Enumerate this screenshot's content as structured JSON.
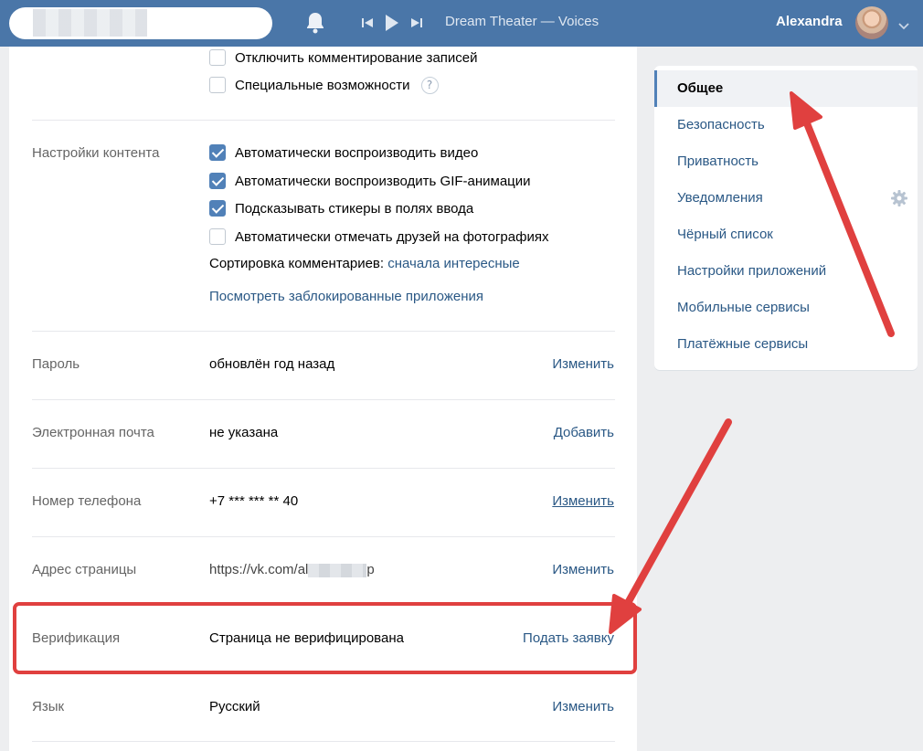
{
  "header": {
    "track": "Dream Theater — Voices",
    "user_name": "Alexandra",
    "icons": [
      "bell-icon",
      "prev-track-icon",
      "play-icon",
      "next-track-icon",
      "chevron-down-icon"
    ]
  },
  "privacy_checkboxes": [
    {
      "label": "Отключить комментирование записей",
      "checked": false
    },
    {
      "label": "Специальные возможности",
      "checked": false,
      "help": "?"
    }
  ],
  "content_settings": {
    "label": "Настройки контента",
    "options": [
      {
        "label": "Автоматически воспроизводить видео",
        "checked": true
      },
      {
        "label": "Автоматически воспроизводить GIF-анимации",
        "checked": true
      },
      {
        "label": "Подсказывать стикеры в полях ввода",
        "checked": true
      },
      {
        "label": "Автоматически отмечать друзей на фотографиях",
        "checked": false
      }
    ],
    "sort_label": "Сортировка комментариев:",
    "sort_value": "сначала интересные",
    "blocked_apps_link": "Посмотреть заблокированные приложения"
  },
  "rows": {
    "password": {
      "label": "Пароль",
      "value": "обновлён год назад",
      "action": "Изменить"
    },
    "email": {
      "label": "Электронная почта",
      "value": "не указана",
      "action": "Добавить"
    },
    "phone": {
      "label": "Номер телефона",
      "value": "+7 *** *** ** 40",
      "action": "Изменить"
    },
    "address": {
      "label": "Адрес страницы",
      "value_prefix": "https://vk.com/al",
      "value_suffix": "p",
      "action": "Изменить"
    },
    "verification": {
      "label": "Верификация",
      "value": "Страница не верифицирована",
      "action": "Подать заявку"
    },
    "language": {
      "label": "Язык",
      "value": "Русский",
      "action": "Изменить"
    }
  },
  "menu": {
    "items": [
      {
        "label": "Общее",
        "active": true
      },
      {
        "label": "Безопасность"
      },
      {
        "label": "Приватность"
      },
      {
        "label": "Уведомления"
      },
      {
        "label": "Чёрный список"
      },
      {
        "label": "Настройки приложений"
      },
      {
        "label": "Мобильные сервисы"
      },
      {
        "label": "Платёжные сервисы"
      }
    ]
  },
  "colors": {
    "header": "#4a76a8",
    "link": "#2a5885",
    "checkbox_on": "#5181b8",
    "annotation_red": "#e0403f"
  }
}
